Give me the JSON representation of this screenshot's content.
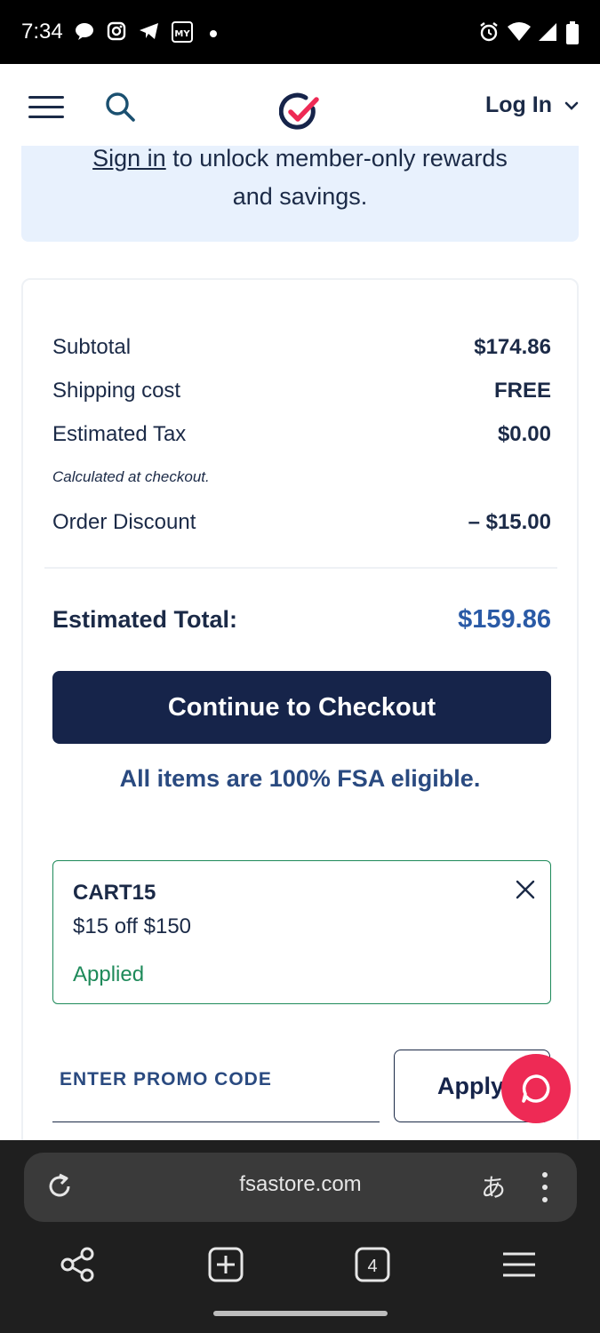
{
  "status_bar": {
    "time": "7:34",
    "left_icons": [
      "chat-bubble-icon",
      "instagram-icon",
      "telegram-icon",
      "mylinco-icon",
      "dot-icon"
    ],
    "right_icons": [
      "alarm-icon",
      "wifi-icon",
      "signal-icon",
      "battery-icon"
    ]
  },
  "header": {
    "menu_icon": "hamburger-icon",
    "search_icon": "search-icon",
    "logo_icon": "checkmark-logo-icon",
    "login_label": "Log In",
    "login_chevron": "chevron-down-icon"
  },
  "banner": {
    "link_text": "Sign in",
    "line1_rest": " to unlock member-only rewards",
    "line2": "and savings."
  },
  "summary": {
    "subtotal_label": "Subtotal",
    "subtotal_value": "$174.86",
    "shipping_label": "Shipping cost",
    "shipping_value": "FREE",
    "tax_label": "Estimated Tax",
    "tax_value": "$0.00",
    "tax_note": "Calculated at checkout.",
    "discount_label": "Order Discount",
    "discount_value": "– $15.00",
    "total_label": "Estimated Total:",
    "total_value": "$159.86",
    "checkout_label": "Continue to Checkout",
    "fsa_note": "All items are 100% FSA eligible."
  },
  "promo": {
    "code": "CART15",
    "description": "$15 off $150",
    "status": "Applied",
    "input_placeholder": "ENTER PROMO CODE",
    "apply_label": "Apply"
  },
  "browser": {
    "url": "fsastore.com",
    "translate_glyph": "あ",
    "tab_count": "4"
  },
  "colors": {
    "navy": "#16244a",
    "accent_blue": "#2a5aa6",
    "success_green": "#1e8a5a",
    "brand_red": "#ee2a55",
    "banner_bg": "#e8f1fd"
  }
}
